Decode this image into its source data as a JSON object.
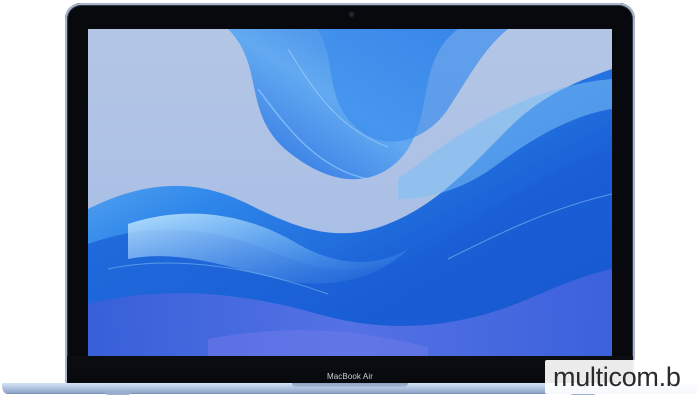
{
  "device": {
    "model_label": "MacBook Air"
  },
  "watermark": {
    "text": "multicom.b"
  },
  "colors": {
    "lid_body": "#a9b6c9",
    "bezel": "#07090d",
    "wallpaper_sky": "#a9c0e4",
    "wallpaper_wave": "#1c6ce0",
    "base": "#b5c7e3"
  }
}
